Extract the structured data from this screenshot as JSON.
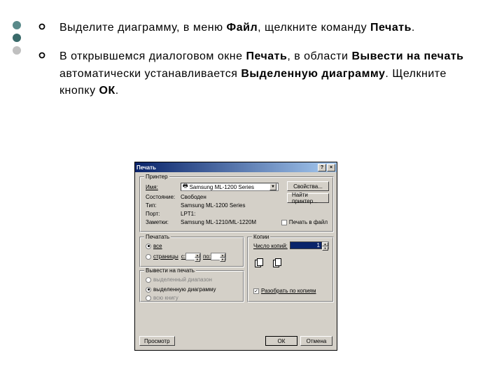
{
  "deco_colors": [
    "#5a8a8a",
    "#3a6a6a",
    "#c0c0c0"
  ],
  "bullets": [
    {
      "runs": [
        {
          "t": "Выделите диаграмму, в меню ",
          "b": false
        },
        {
          "t": "Файл",
          "b": true
        },
        {
          "t": ", щелкните команду ",
          "b": false
        },
        {
          "t": "Печать",
          "b": true
        },
        {
          "t": ".",
          "b": false
        }
      ]
    },
    {
      "runs": [
        {
          "t": "В открывшемся диалоговом окне ",
          "b": false
        },
        {
          "t": "Печать",
          "b": true
        },
        {
          "t": ", в области ",
          "b": false
        },
        {
          "t": "Вывести на печать",
          "b": true
        },
        {
          "t": " автоматически устанавливается ",
          "b": false
        },
        {
          "t": "Выделенную диаграмму",
          "b": true
        },
        {
          "t": ". Щелкните кнопку ",
          "b": false
        },
        {
          "t": "ОК",
          "b": true
        },
        {
          "t": ".",
          "b": false
        }
      ]
    }
  ],
  "dialog": {
    "title": "Печать",
    "help_btn": "?",
    "close_btn": "×",
    "printer": {
      "group": "Принтер",
      "name_label": "Имя:",
      "name_value": "Samsung ML-1200 Series",
      "properties_btn": "Свойства...",
      "find_btn": "Найти принтер...",
      "status_label": "Состояние:",
      "status_value": "Свободен",
      "type_label": "Тип:",
      "type_value": "Samsung ML-1200 Series",
      "port_label": "Порт:",
      "port_value": "LPT1:",
      "notes_label": "Заметки:",
      "notes_value": "Samsung ML-1210/ML-1220M",
      "to_file_label": "Печать в файл"
    },
    "range": {
      "group": "Печатать",
      "all_label": "все",
      "pages_label": "страницы",
      "from_label": "с:",
      "to_label": "по:"
    },
    "copies": {
      "group": "Копии",
      "count_label": "Число копий:",
      "count_value": "1",
      "collate_label": "Разобрать по копиям"
    },
    "output": {
      "group": "Вывести на печать",
      "range_label": "выделенный диапазон",
      "chart_label": "выделенную диаграмму",
      "book_label": "всю книгу"
    },
    "preview_btn": "Просмотр",
    "ok_btn": "ОК",
    "cancel_btn": "Отмена"
  }
}
